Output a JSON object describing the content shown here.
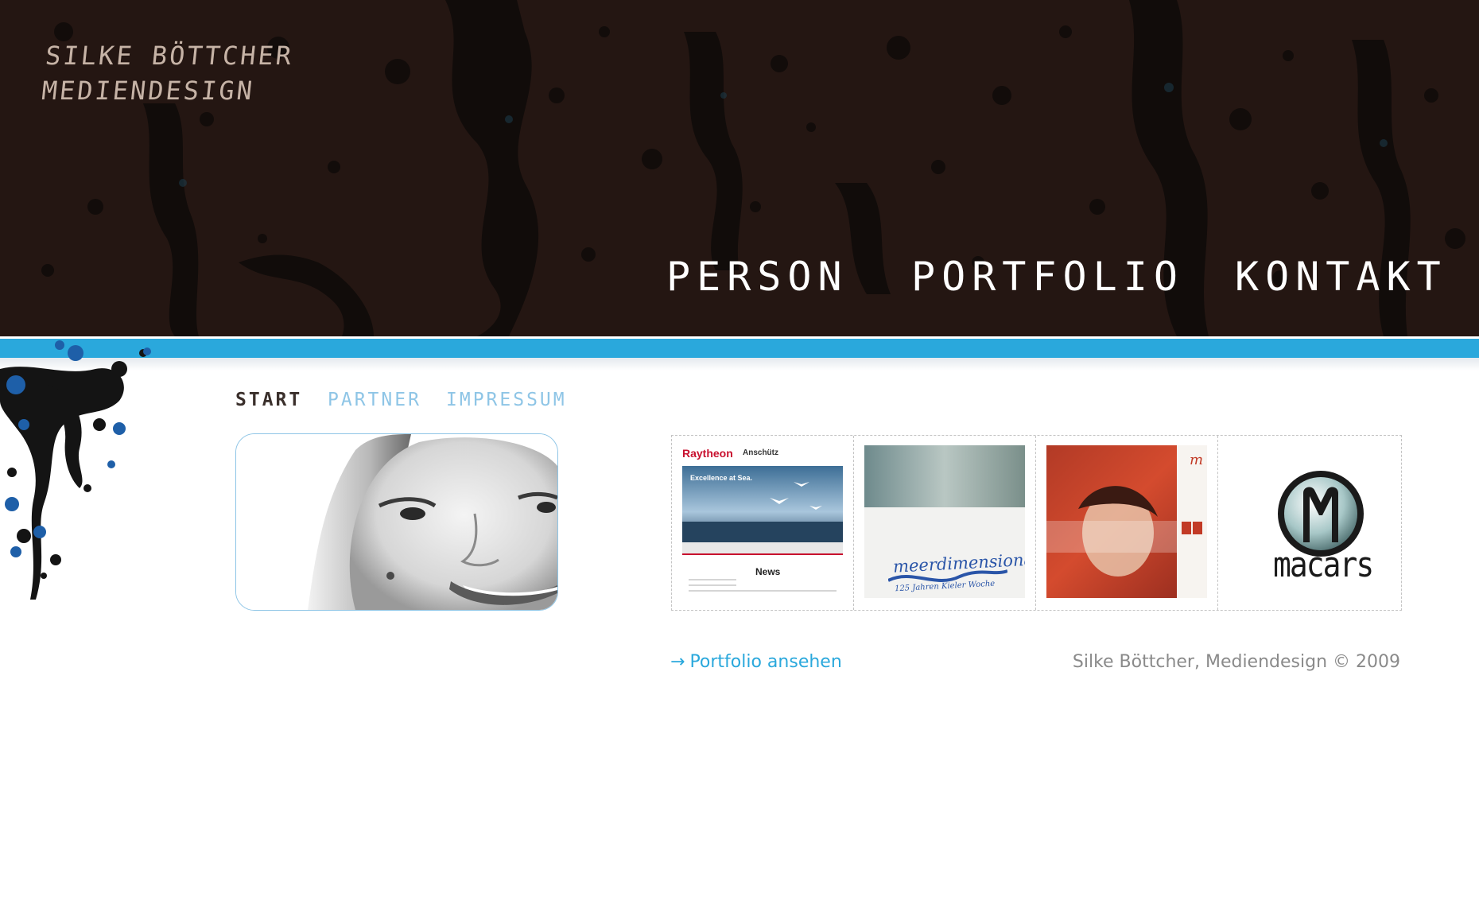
{
  "logo": {
    "line1": "Silke Böttcher",
    "line2": "Mediendesign"
  },
  "main_nav": {
    "person": "PERSON",
    "portfolio": "PORTFOLIO",
    "kontakt": "KONTAKT"
  },
  "sub_nav": {
    "start": "START",
    "partner": "PARTNER",
    "impressum": "IMPRESSUM"
  },
  "portfolio_items": [
    {
      "brand": "Raytheon",
      "brand_suffix": "Anschütz",
      "hero_text": "Excellence at Sea.",
      "section_title": "News"
    },
    {
      "logo_text": "meerdimensional",
      "caption": "125 Jahren Kieler Woche"
    },
    {
      "logo_text": "m"
    },
    {
      "logo_text": "macars"
    }
  ],
  "footer": {
    "portfolio_link_arrow": "→",
    "portfolio_link_label": "Portfolio ansehen",
    "copyright": "Silke Böttcher, Mediendesign © 2009"
  },
  "colors": {
    "header_bg": "#241612",
    "accent_blue": "#2aa8dc",
    "light_blue": "#8ec5e6",
    "raytheon_red": "#c8102e"
  }
}
